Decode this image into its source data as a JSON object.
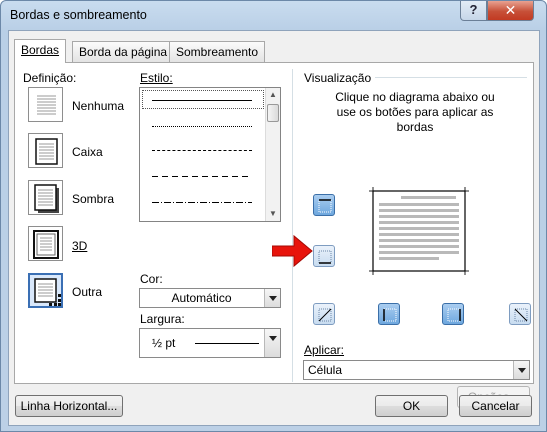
{
  "window": {
    "title": "Bordas e sombreamento"
  },
  "title_buttons": {
    "help": "?",
    "close": "✕"
  },
  "tabs": [
    {
      "label": "Bordas",
      "active": true
    },
    {
      "label": "Borda da página",
      "active": false
    },
    {
      "label": "Sombreamento",
      "active": false
    }
  ],
  "definition": {
    "label": "Definição:",
    "items": [
      {
        "label": "Nenhuma",
        "icon": "none-border-icon"
      },
      {
        "label": "Caixa",
        "icon": "box-border-icon"
      },
      {
        "label": "Sombra",
        "icon": "shadow-border-icon"
      },
      {
        "label": "3D",
        "icon": "3d-border-icon"
      },
      {
        "label": "Outra",
        "icon": "custom-border-icon",
        "selected": true
      }
    ]
  },
  "style": {
    "label": "Estilo:",
    "lines": [
      "solid",
      "dotted",
      "dashed",
      "long-dashed",
      "dash-dot"
    ]
  },
  "color": {
    "label": "Cor:",
    "value": "Automático"
  },
  "width": {
    "label": "Largura:",
    "value": "½ pt"
  },
  "preview": {
    "label": "Visualização",
    "hint": "Clique no diagrama abaixo ou use os botões para aplicar as bordas"
  },
  "apply": {
    "label": "Aplicar:",
    "value": "Célula"
  },
  "buttons": {
    "options": "Opções...",
    "horizontal_line": "Linha Horizontal...",
    "ok": "OK",
    "cancel": "Cancelar"
  },
  "colors": {
    "accent": "#3a6fb4",
    "arrow": "#e8140c",
    "title_bar": "#c9dcef"
  }
}
